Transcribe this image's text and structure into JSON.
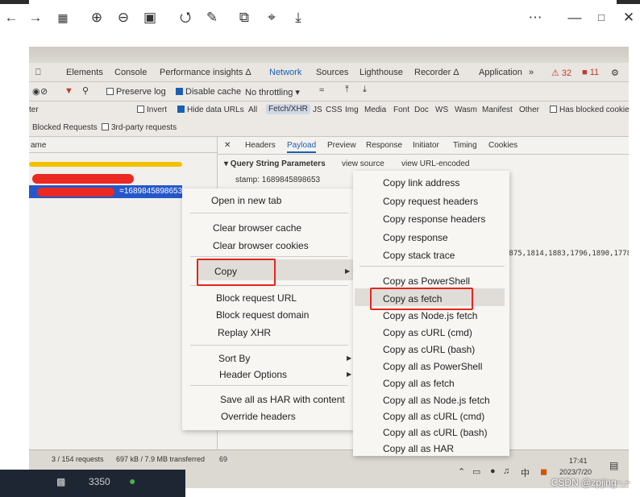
{
  "viewer": {
    "icons": [
      "back-icon",
      "forward-icon",
      "grid-icon",
      "zoom-in-icon",
      "zoom-out-icon",
      "fit-icon",
      "rotate-icon",
      "edit-icon",
      "copy-icon",
      "crop-icon",
      "save-icon",
      "more-icon",
      "minimize-icon",
      "maximize-icon",
      "close-icon"
    ]
  },
  "devtools": {
    "tabs": [
      "Elements",
      "Console",
      "Performance insights Δ",
      "Network",
      "Sources",
      "Lighthouse",
      "Recorder Δ",
      "Application",
      "»"
    ],
    "active_tab": "Network",
    "errors": "32",
    "issues": "11",
    "toolbar": {
      "preserve_log": "Preserve log",
      "disable_cache": "Disable cache",
      "throttling": "No throttling"
    },
    "filter": {
      "partial_label": "ter",
      "invert": "Invert",
      "hide_data_urls": "Hide data URLs",
      "types": [
        "All",
        "Fetch/XHR",
        "JS",
        "CSS",
        "Img",
        "Media",
        "Font",
        "Doc",
        "WS",
        "Wasm",
        "Manifest",
        "Other"
      ],
      "has_blocked_cookies": "Has blocked cookies",
      "blocked_requests": "Blocked Requests",
      "third_party": "3rd-party requests"
    },
    "list": {
      "name_header": "ame",
      "selected_suffix": "=1689845898653"
    },
    "payload": {
      "tabs": [
        "Headers",
        "Payload",
        "Preview",
        "Response",
        "Initiator",
        "Timing",
        "Cookies"
      ],
      "active": "Payload",
      "section_title": "▾ Query String Parameters",
      "view_source": "view source",
      "view_url_encoded": "view URL-encoded",
      "stamp": "stamp: 1689845898653",
      "numbers": "1875,1814,1883,1796,1890,1778,"
    },
    "status": "3 / 154 requests",
    "transferred": "697 kB / 7.9 MB transferred",
    "transferred_tail": "69"
  },
  "menu1": {
    "items": [
      "Open in new tab",
      "Clear browser cache",
      "Clear browser cookies",
      "Copy",
      "Block request URL",
      "Block request domain",
      "Replay XHR",
      "Sort By",
      "Header Options",
      "Save all as HAR with content",
      "Override headers"
    ]
  },
  "menu2": {
    "items": [
      "Copy link address",
      "Copy request headers",
      "Copy response headers",
      "Copy response",
      "Copy stack trace",
      "Copy as PowerShell",
      "Copy as fetch",
      "Copy as Node.js fetch",
      "Copy as cURL (cmd)",
      "Copy as cURL (bash)",
      "Copy all as PowerShell",
      "Copy all as fetch",
      "Copy all as Node.js fetch",
      "Copy all as cURL (cmd)",
      "Copy all as cURL (bash)",
      "Copy all as HAR"
    ]
  },
  "photo_taskbar": {
    "time": "17:41",
    "date": "2023/7/20",
    "ime": "中"
  },
  "bottom": {
    "number": "3350",
    "watermark": "CSDN @zpjing~.~"
  },
  "colors": {
    "highlight_red": "#e3261d",
    "selected_row": "#2557c9",
    "yellow_mark": "#f2c200"
  }
}
